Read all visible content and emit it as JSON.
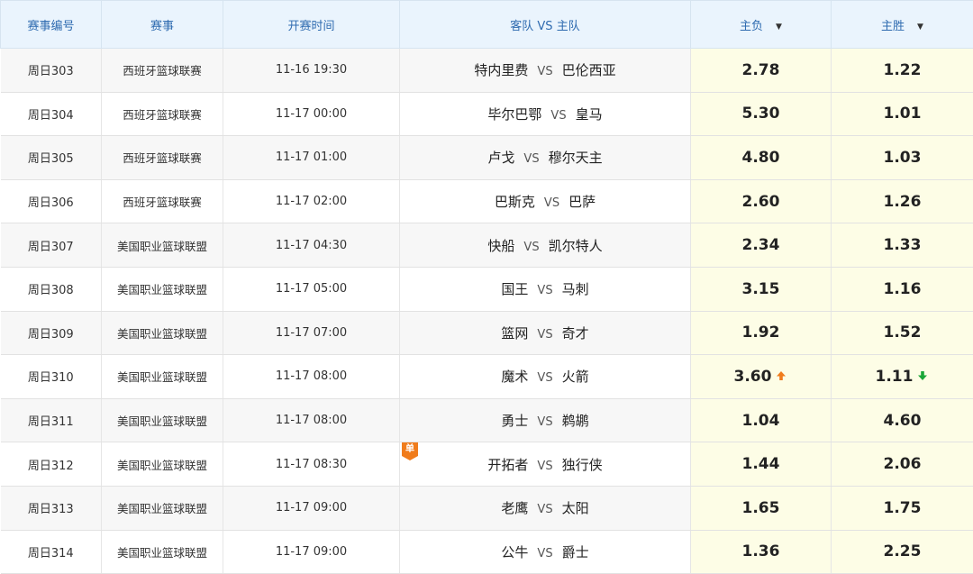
{
  "headers": {
    "code": "赛事编号",
    "league": "赛事",
    "time": "开赛时间",
    "match": "客队 VS 主队",
    "away_loss": "主负",
    "home_win": "主胜"
  },
  "vs_text": "VS",
  "single_badge_text": "单",
  "colors": {
    "up": "#f07c1c",
    "down": "#1aa637",
    "header_text": "#2f6bb0",
    "odds_bg": "#fdfde6"
  },
  "rows": [
    {
      "code": "周日303",
      "league": "西班牙篮球联赛",
      "time": "11-16 19:30",
      "away": "特内里费",
      "home": "巴伦西亚",
      "loss": "2.78",
      "win": "1.22",
      "loss_trend": "",
      "win_trend": "",
      "single": false
    },
    {
      "code": "周日304",
      "league": "西班牙篮球联赛",
      "time": "11-17 00:00",
      "away": "毕尔巴鄂",
      "home": "皇马",
      "loss": "5.30",
      "win": "1.01",
      "loss_trend": "",
      "win_trend": "",
      "single": false
    },
    {
      "code": "周日305",
      "league": "西班牙篮球联赛",
      "time": "11-17 01:00",
      "away": "卢戈",
      "home": "穆尔天主",
      "loss": "4.80",
      "win": "1.03",
      "loss_trend": "",
      "win_trend": "",
      "single": false
    },
    {
      "code": "周日306",
      "league": "西班牙篮球联赛",
      "time": "11-17 02:00",
      "away": "巴斯克",
      "home": "巴萨",
      "loss": "2.60",
      "win": "1.26",
      "loss_trend": "",
      "win_trend": "",
      "single": false
    },
    {
      "code": "周日307",
      "league": "美国职业篮球联盟",
      "time": "11-17 04:30",
      "away": "快船",
      "home": "凯尔特人",
      "loss": "2.34",
      "win": "1.33",
      "loss_trend": "",
      "win_trend": "",
      "single": false
    },
    {
      "code": "周日308",
      "league": "美国职业篮球联盟",
      "time": "11-17 05:00",
      "away": "国王",
      "home": "马刺",
      "loss": "3.15",
      "win": "1.16",
      "loss_trend": "",
      "win_trend": "",
      "single": false
    },
    {
      "code": "周日309",
      "league": "美国职业篮球联盟",
      "time": "11-17 07:00",
      "away": "篮网",
      "home": "奇才",
      "loss": "1.92",
      "win": "1.52",
      "loss_trend": "",
      "win_trend": "",
      "single": false
    },
    {
      "code": "周日310",
      "league": "美国职业篮球联盟",
      "time": "11-17 08:00",
      "away": "魔术",
      "home": "火箭",
      "loss": "3.60",
      "win": "1.11",
      "loss_trend": "up",
      "win_trend": "down",
      "single": false
    },
    {
      "code": "周日311",
      "league": "美国职业篮球联盟",
      "time": "11-17 08:00",
      "away": "勇士",
      "home": "鹈鹕",
      "loss": "1.04",
      "win": "4.60",
      "loss_trend": "",
      "win_trend": "",
      "single": false
    },
    {
      "code": "周日312",
      "league": "美国职业篮球联盟",
      "time": "11-17 08:30",
      "away": "开拓者",
      "home": "独行侠",
      "loss": "1.44",
      "win": "2.06",
      "loss_trend": "",
      "win_trend": "",
      "single": true
    },
    {
      "code": "周日313",
      "league": "美国职业篮球联盟",
      "time": "11-17 09:00",
      "away": "老鹰",
      "home": "太阳",
      "loss": "1.65",
      "win": "1.75",
      "loss_trend": "",
      "win_trend": "",
      "single": false
    },
    {
      "code": "周日314",
      "league": "美国职业篮球联盟",
      "time": "11-17 09:00",
      "away": "公牛",
      "home": "爵士",
      "loss": "1.36",
      "win": "2.25",
      "loss_trend": "",
      "win_trend": "",
      "single": false
    }
  ]
}
